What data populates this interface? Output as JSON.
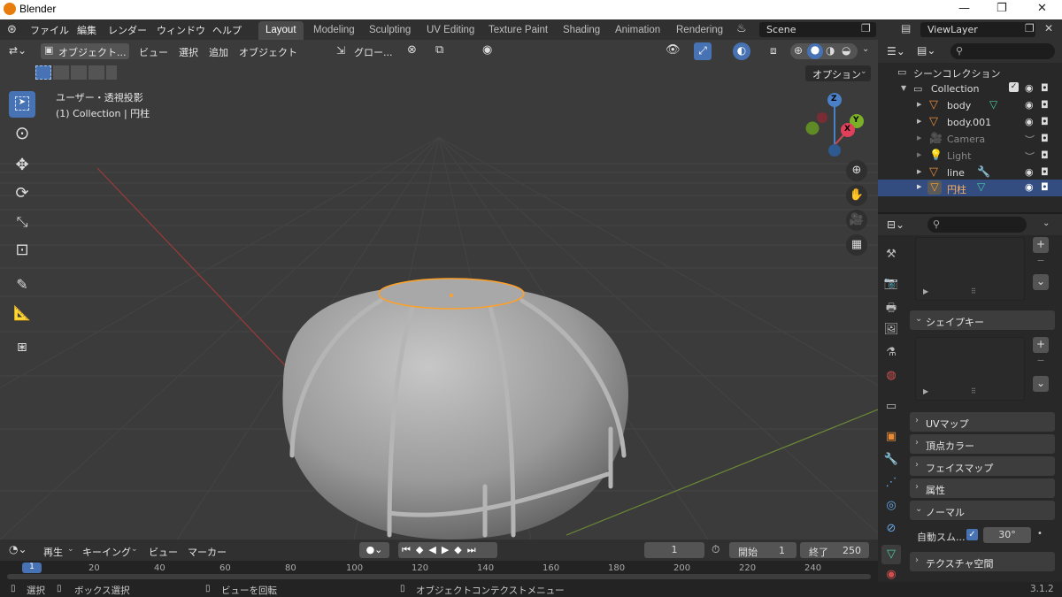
{
  "window": {
    "title": "Blender",
    "min": "—",
    "max": "❐",
    "close": "✕"
  },
  "menus": [
    "ファイル",
    "編集",
    "レンダー",
    "ウィンドウ",
    "ヘルプ"
  ],
  "workspaces": [
    "Layout",
    "Modeling",
    "Sculpting",
    "UV Editing",
    "Texture Paint",
    "Shading",
    "Animation",
    "Rendering"
  ],
  "scene": "Scene",
  "viewlayer": "ViewLayer",
  "vp_header": {
    "mode": "オブジェクト...",
    "view": "ビュー",
    "select": "選択",
    "add": "追加",
    "object": "オブジェクト",
    "transform": "グロー...",
    "options": "オプション"
  },
  "vp_info": {
    "line1": "ユーザー・透視投影",
    "line2": "(1) Collection | 円柱"
  },
  "gizmo": {
    "x": "X",
    "y": "Y",
    "z": "Z"
  },
  "outliner": {
    "scene_collection": "シーンコレクション",
    "collection": "Collection",
    "items": [
      {
        "name": "body"
      },
      {
        "name": "body.001"
      },
      {
        "name": "Camera"
      },
      {
        "name": "Light"
      },
      {
        "name": "line"
      },
      {
        "name": "円柱"
      }
    ]
  },
  "props": {
    "shape_keys": "シェイプキー",
    "uv_maps": "UVマップ",
    "vertex_colors": "頂点カラー",
    "face_maps": "フェイスマップ",
    "attributes": "属性",
    "normals": "ノーマル",
    "auto_smooth": "自動スム...",
    "angle": "30°",
    "texture_space": "テクスチャ空間"
  },
  "timeline": {
    "playback": "再生",
    "keying": "キーイング",
    "view": "ビュー",
    "marker": "マーカー",
    "current": "1",
    "start_label": "開始",
    "start": "1",
    "end_label": "終了",
    "end": "250",
    "ticks": [
      "1",
      "20",
      "40",
      "60",
      "80",
      "100",
      "120",
      "140",
      "160",
      "180",
      "200",
      "220",
      "240"
    ]
  },
  "status": {
    "select": "選択",
    "box_select": "ボックス選択",
    "rotate": "ビューを回転",
    "context": "オブジェクトコンテクストメニュー",
    "version": "3.1.2"
  },
  "colors": {
    "accent": "#4772b3",
    "selected": "#ffa028",
    "bg": "#3b3b3b"
  }
}
